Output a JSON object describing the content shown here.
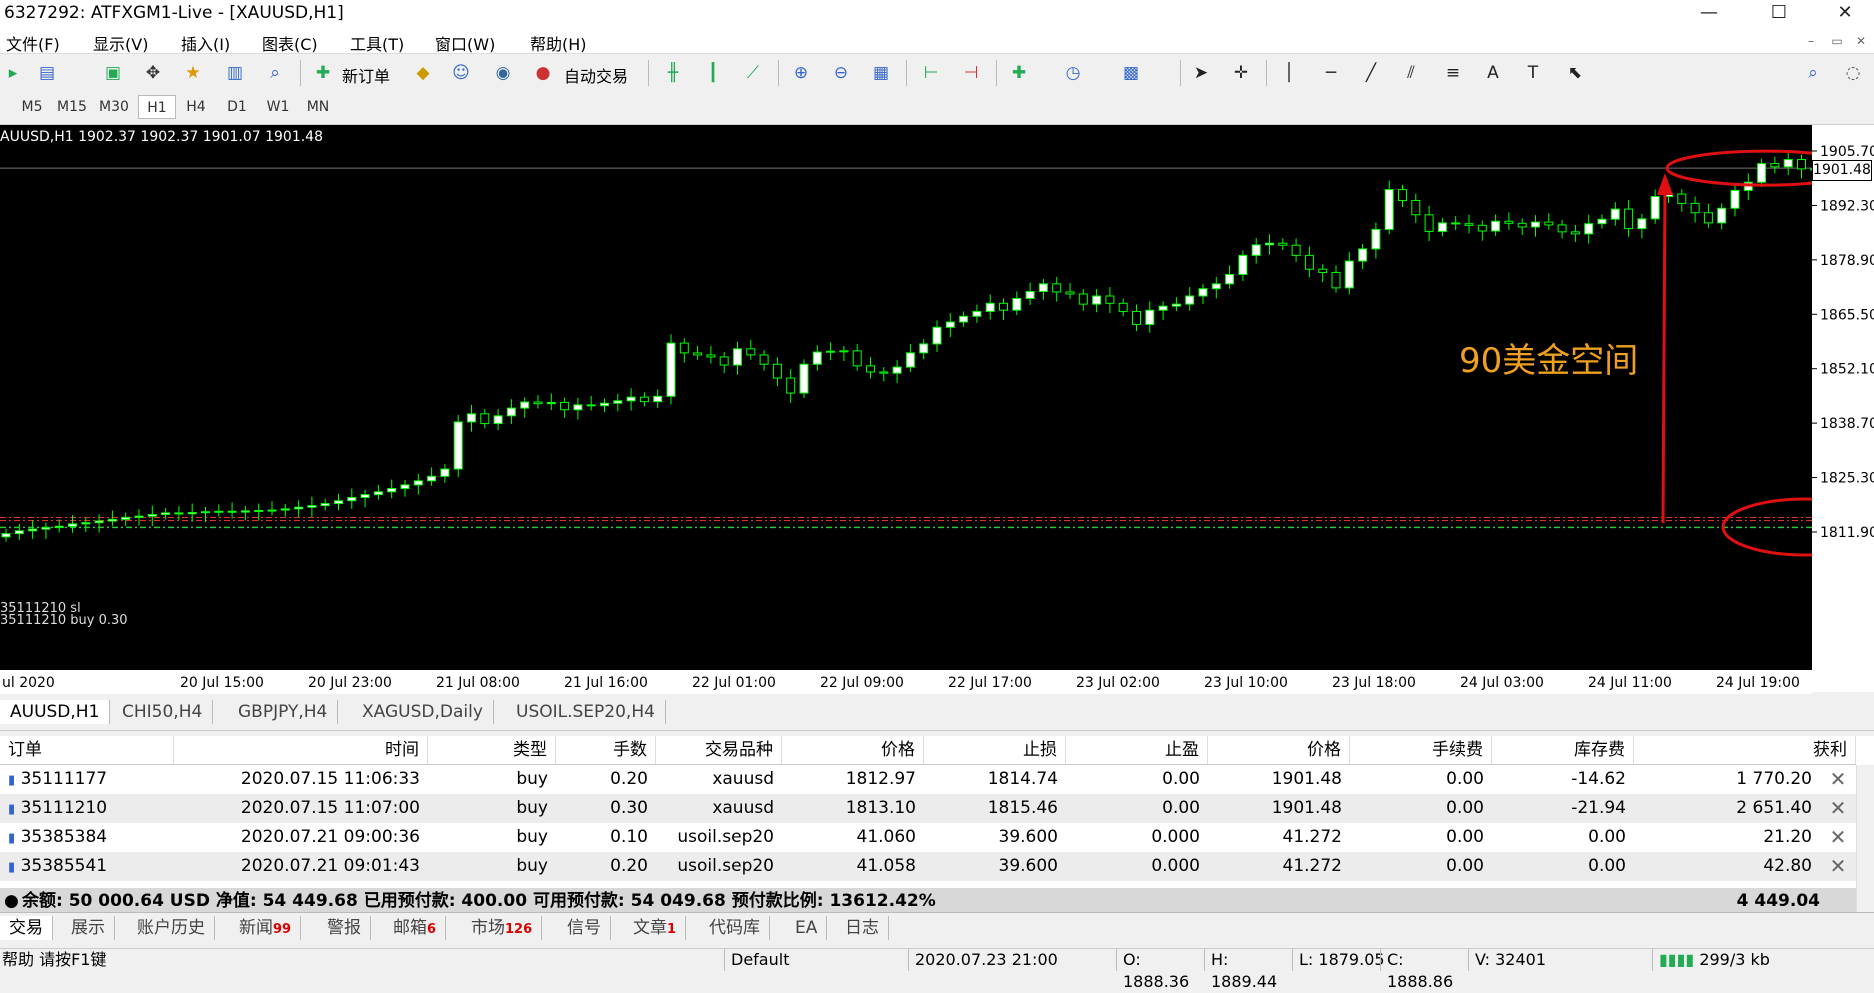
{
  "window": {
    "title": "6327292: ATFXGM1-Live - [XAUUSD,H1]",
    "minimize": "—",
    "maximize": "☐",
    "close": "✕"
  },
  "menu": [
    "文件(F)",
    "显示(V)",
    "插入(I)",
    "图表(C)",
    "工具(T)",
    "窗口(W)",
    "帮助(H)"
  ],
  "toolbar": {
    "new_order": "新订单",
    "auto_trade": "自动交易"
  },
  "timeframes": [
    "M5",
    "M15",
    "M30",
    "H1",
    "H4",
    "D1",
    "W1",
    "MN"
  ],
  "timeframe_active": "H1",
  "chart": {
    "header": "AUUSD,H1  1902.37 1902.37 1901.07 1901.48",
    "order_label_1": "35111210 sl",
    "order_label_2": "35111210 buy 0.30",
    "annotation": "90美金空间",
    "bid_label": "1901.48",
    "background": "#000000",
    "bull_color": "#ffffff",
    "outline_color": "#00ff00",
    "annotation_color": "#f0a020",
    "marker_color": "#e01010"
  },
  "chart_data": {
    "type": "candlestick",
    "y_ticks": [
      "1905.70",
      "1892.30",
      "1878.90",
      "1865.50",
      "1852.10",
      "1838.70",
      "1825.30",
      "1811.90"
    ],
    "x_ticks": [
      "ul 2020",
      "20 Jul 15:00",
      "20 Jul 23:00",
      "21 Jul 08:00",
      "21 Jul 16:00",
      "22 Jul 01:00",
      "22 Jul 09:00",
      "22 Jul 17:00",
      "23 Jul 02:00",
      "23 Jul 10:00",
      "23 Jul 18:00",
      "24 Jul 03:00",
      "24 Jul 11:00",
      "24 Jul 19:00"
    ],
    "ylim": [
      1808,
      1908
    ],
    "close_prices": [
      1811.5,
      1812.2,
      1812.6,
      1813.0,
      1813.3,
      1813.9,
      1814.2,
      1814.6,
      1815.0,
      1815.5,
      1815.8,
      1816.2,
      1816.6,
      1816.4,
      1816.7,
      1816.9,
      1817.0,
      1816.8,
      1817.1,
      1817.2,
      1817.3,
      1817.6,
      1818.0,
      1818.4,
      1818.9,
      1819.6,
      1820.4,
      1821.1,
      1821.8,
      1822.6,
      1823.5,
      1824.5,
      1825.6,
      1827.4,
      1839.0,
      1841.0,
      1838.6,
      1840.5,
      1842.4,
      1843.9,
      1843.5,
      1843.8,
      1842.0,
      1843.2,
      1843.0,
      1843.6,
      1844.2,
      1845.1,
      1844.0,
      1845.3,
      1858.4,
      1856.0,
      1855.5,
      1855.0,
      1853.0,
      1857.0,
      1855.5,
      1853.2,
      1849.8,
      1846.1,
      1853.2,
      1856.2,
      1856.4,
      1856.5,
      1852.8,
      1851.3,
      1851.0,
      1852.5,
      1856.0,
      1858.2,
      1862.3,
      1863.6,
      1865.0,
      1866.2,
      1868.2,
      1866.5,
      1869.4,
      1871.1,
      1873.0,
      1871.0,
      1870.5,
      1868.0,
      1870.0,
      1868.2,
      1866.2,
      1863.0,
      1866.5,
      1867.5,
      1868.0,
      1870.0,
      1871.8,
      1873.0,
      1875.3,
      1880.0,
      1882.6,
      1883.0,
      1882.5,
      1880.0,
      1876.6,
      1875.8,
      1872.0,
      1878.6,
      1881.6,
      1886.4,
      1896.2,
      1893.5,
      1890.0,
      1885.9,
      1888.0,
      1887.8,
      1887.4,
      1886.0,
      1888.4,
      1887.9,
      1887.0,
      1888.2,
      1887.5,
      1885.8,
      1885.3,
      1887.8,
      1888.9,
      1891.4,
      1886.6,
      1889.0,
      1894.5,
      1895.1,
      1892.8,
      1890.5,
      1888.0,
      1891.6,
      1896.0,
      1898.0,
      1902.6,
      1901.8,
      1903.6,
      1901.3,
      1901.0,
      1900.6,
      1901.4,
      1901.9,
      1902.3,
      1901.48
    ]
  },
  "symbol_tabs": [
    "AUUSD,H1",
    "CHI50,H4",
    "GBPJPY,H4",
    "XAGUSD,Daily",
    "USOIL.SEP20,H4"
  ],
  "orders": {
    "columns": [
      "订单",
      "时间",
      "类型",
      "手数",
      "交易品种",
      "价格",
      "止损",
      "止盈",
      "价格",
      "手续费",
      "库存费",
      "获利"
    ],
    "rows": [
      [
        "35111177",
        "2020.07.15 11:06:33",
        "buy",
        "0.20",
        "xauusd",
        "1812.97",
        "1814.74",
        "0.00",
        "1901.48",
        "0.00",
        "-14.62",
        "1 770.20"
      ],
      [
        "35111210",
        "2020.07.15 11:07:00",
        "buy",
        "0.30",
        "xauusd",
        "1813.10",
        "1815.46",
        "0.00",
        "1901.48",
        "0.00",
        "-21.94",
        "2 651.40"
      ],
      [
        "35385384",
        "2020.07.21 09:00:36",
        "buy",
        "0.10",
        "usoil.sep20",
        "41.060",
        "39.600",
        "0.000",
        "41.272",
        "0.00",
        "0.00",
        "21.20"
      ],
      [
        "35385541",
        "2020.07.21 09:01:43",
        "buy",
        "0.20",
        "usoil.sep20",
        "41.058",
        "39.600",
        "0.000",
        "41.272",
        "0.00",
        "0.00",
        "42.80"
      ]
    ],
    "summary": "余额: 50 000.64 USD  净值: 54 449.68  已用预付款: 400.00  可用预付款: 54 049.68  预付款比例: 13612.42%",
    "summary_total": "4 449.04"
  },
  "bottom_tabs": [
    {
      "label": "交易",
      "badge": ""
    },
    {
      "label": "展示",
      "badge": ""
    },
    {
      "label": "账户历史",
      "badge": ""
    },
    {
      "label": "新闻",
      "badge": "99"
    },
    {
      "label": "警报",
      "badge": ""
    },
    {
      "label": "邮箱",
      "badge": "6"
    },
    {
      "label": "市场",
      "badge": "126"
    },
    {
      "label": "信号",
      "badge": ""
    },
    {
      "label": "文章",
      "badge": "1"
    },
    {
      "label": "代码库",
      "badge": ""
    },
    {
      "label": "EA",
      "badge": ""
    },
    {
      "label": "日志",
      "badge": ""
    }
  ],
  "status": {
    "help": "帮助 请按F1键",
    "profile": "Default",
    "datetime": "2020.07.23 21:00",
    "open": "O: 1888.36",
    "high": "H: 1889.44",
    "low": "L: 1879.05",
    "close": "C: 1888.86",
    "volume": "V: 32401",
    "traffic": "299/3 kb"
  }
}
